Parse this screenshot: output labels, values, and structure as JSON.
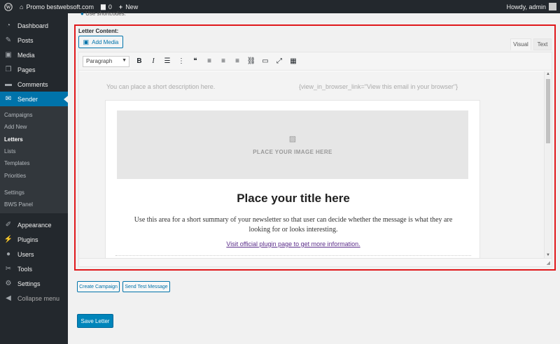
{
  "admin_bar": {
    "site_name": "Promo bestwebsoft.com",
    "comments_count": "0",
    "new_label": "New",
    "howdy": "Howdy, admin"
  },
  "sidebar": {
    "items_top": [
      {
        "label": "Dashboard",
        "icon": "dashboard-icon",
        "glyph": "◔"
      },
      {
        "label": "Posts",
        "icon": "pin-icon",
        "glyph": "✎"
      },
      {
        "label": "Media",
        "icon": "media-icon",
        "glyph": "▣"
      },
      {
        "label": "Pages",
        "icon": "pages-icon",
        "glyph": "❐"
      },
      {
        "label": "Comments",
        "icon": "comment-icon",
        "glyph": "▬"
      },
      {
        "label": "Sender",
        "icon": "sender-icon",
        "glyph": "✉"
      }
    ],
    "submenu": [
      "Campaigns",
      "Add New",
      "Letters",
      "Lists",
      "Templates",
      "Priorities"
    ],
    "submenu2": [
      "Settings",
      "BWS Panel"
    ],
    "items_bottom": [
      {
        "label": "Appearance",
        "icon": "brush-icon",
        "glyph": "✐"
      },
      {
        "label": "Plugins",
        "icon": "plugin-icon",
        "glyph": "⚡"
      },
      {
        "label": "Users",
        "icon": "user-icon",
        "glyph": "●"
      },
      {
        "label": "Tools",
        "icon": "wrench-icon",
        "glyph": "✂"
      },
      {
        "label": "Settings",
        "icon": "settings-icon",
        "glyph": "⚙"
      },
      {
        "label": "Collapse menu",
        "icon": "collapse-icon",
        "glyph": "◀"
      }
    ]
  },
  "main": {
    "top_hint": "Use shortcodes.",
    "letter_label": "Letter Content:",
    "add_media": "Add Media",
    "tab_visual": "Visual",
    "tab_text": "Text",
    "format_select": "Paragraph",
    "description_placeholder": "You can place a short description here.",
    "view_in_browser": "{view_in_browser_link=\"View this email in your browser\"}",
    "image_placeholder": "PLACE YOUR IMAGE HERE",
    "title_placeholder": "Place your title here",
    "summary": "Use this area for a short summary of your newsletter so that user can decide whether the message is what they are looking for or looks interesting.",
    "plugin_link": "Visit official plugin page to get more information.",
    "create_campaign": "Create Campaign",
    "send_test": "Send Test Message",
    "save_letter": "Save Letter"
  },
  "toolbar_buttons": [
    {
      "name": "bold-button",
      "glyph": "B"
    },
    {
      "name": "italic-button",
      "glyph": "I"
    },
    {
      "name": "bullet-list-button",
      "glyph": "☰"
    },
    {
      "name": "numbered-list-button",
      "glyph": "⋮"
    },
    {
      "name": "blockquote-button",
      "glyph": "❝"
    },
    {
      "name": "align-left-button",
      "glyph": "≡"
    },
    {
      "name": "align-center-button",
      "glyph": "≡"
    },
    {
      "name": "align-right-button",
      "glyph": "≡"
    },
    {
      "name": "link-button",
      "glyph": "⛓"
    },
    {
      "name": "read-more-button",
      "glyph": "▭"
    },
    {
      "name": "fullscreen-button",
      "glyph": "⤢"
    },
    {
      "name": "toolbar-toggle-button",
      "glyph": "▦"
    }
  ],
  "colors": {
    "accent": "#0073aa",
    "highlight_border": "#e0181b",
    "sidebar_bg": "#23282d"
  }
}
